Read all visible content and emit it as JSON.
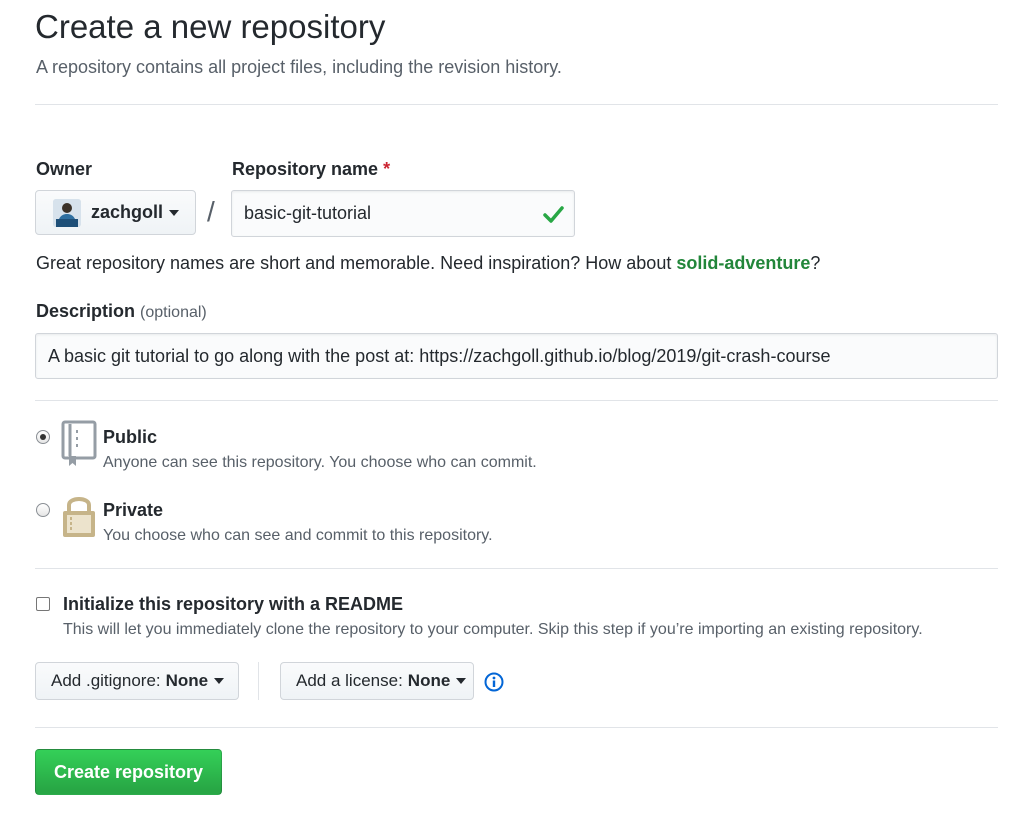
{
  "header": {
    "title": "Create a new repository",
    "subtitle": "A repository contains all project files, including the revision history."
  },
  "owner": {
    "label": "Owner",
    "value": "zachgoll"
  },
  "repo_name": {
    "label": "Repository name",
    "required_mark": "*",
    "value": "basic-git-tutorial",
    "separator": "/"
  },
  "hint": {
    "text": "Great repository names are short and memorable. Need inspiration? How about ",
    "suggestion": "solid-adventure",
    "end": "?"
  },
  "description": {
    "label": "Description",
    "optional": "(optional)",
    "value": "A basic git tutorial to go along with the post at: https://zachgoll.github.io/blog/2019/git-crash-course"
  },
  "visibility": {
    "selected": "public",
    "public": {
      "title": "Public",
      "description": "Anyone can see this repository. You choose who can commit."
    },
    "private": {
      "title": "Private",
      "description": "You choose who can see and commit to this repository."
    }
  },
  "readme": {
    "checked": false,
    "label": "Initialize this repository with a README",
    "description": "This will let you immediately clone the repository to your computer. Skip this step if you’re importing an existing repository."
  },
  "gitignore": {
    "label": "Add .gitignore:",
    "value": "None"
  },
  "license": {
    "label": "Add a license:",
    "value": "None"
  },
  "submit": {
    "label": "Create repository"
  },
  "colors": {
    "accent_green": "#2ea44f",
    "suggestion_green": "#22863a",
    "info_blue": "#0366d6",
    "required_red": "#cb2431",
    "lock_gold": "#c6b489"
  },
  "icons": [
    "check-icon",
    "repo-icon",
    "lock-icon",
    "info-icon",
    "chevron-down-icon"
  ]
}
